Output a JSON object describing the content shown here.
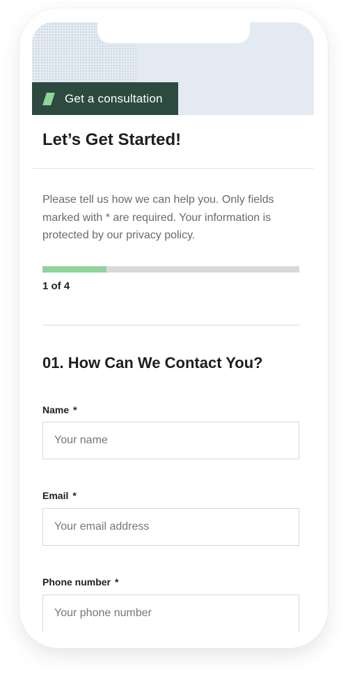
{
  "banner": {
    "tab_label": "Get a consultation",
    "accent_color": "#8fd49a",
    "tab_color": "#2c4a40"
  },
  "page": {
    "title": "Let’s Get Started!",
    "intro": "Please tell us how we can help you. Only fields marked with * are required. Your information is protected by our privacy policy."
  },
  "progress": {
    "percent": 25,
    "step_text": "1 of 4"
  },
  "section": {
    "title": "01. How Can We Contact You?"
  },
  "form": {
    "required_marker": "*",
    "name": {
      "label": "Name",
      "placeholder": "Your name",
      "value": ""
    },
    "email": {
      "label": "Email",
      "placeholder": "Your email address",
      "value": ""
    },
    "phone": {
      "label": "Phone number",
      "placeholder": "Your phone number",
      "value": ""
    }
  }
}
